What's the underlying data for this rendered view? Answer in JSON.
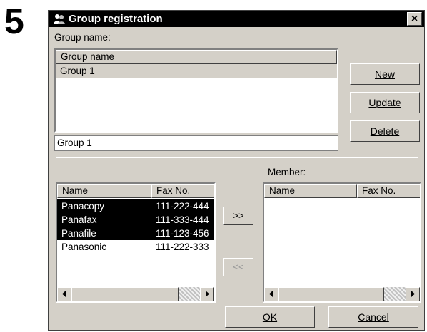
{
  "step_number": "5",
  "dialog": {
    "title": "Group registration",
    "close_label": "×"
  },
  "group_section": {
    "label": "Group name:",
    "list_header": "Group name",
    "items": [
      "Group 1"
    ],
    "name_input_value": "Group 1"
  },
  "buttons": {
    "new_label": "New",
    "update_label": "Update",
    "delete_label": "Delete",
    "add_label": ">>",
    "remove_label": "<<",
    "ok_label": "OK",
    "cancel_label": "Cancel"
  },
  "directory": {
    "columns": [
      "Name",
      "Fax No."
    ],
    "rows": [
      {
        "name": "Panacopy",
        "fax": "111-222-444",
        "selected": true
      },
      {
        "name": "Panafax",
        "fax": "111-333-444",
        "selected": true
      },
      {
        "name": "Panafile",
        "fax": "111-123-456",
        "selected": true
      },
      {
        "name": "Panasonic",
        "fax": "111-222-333",
        "selected": false
      }
    ]
  },
  "members": {
    "label": "Member:",
    "columns": [
      "Name",
      "Fax No."
    ],
    "rows": []
  }
}
